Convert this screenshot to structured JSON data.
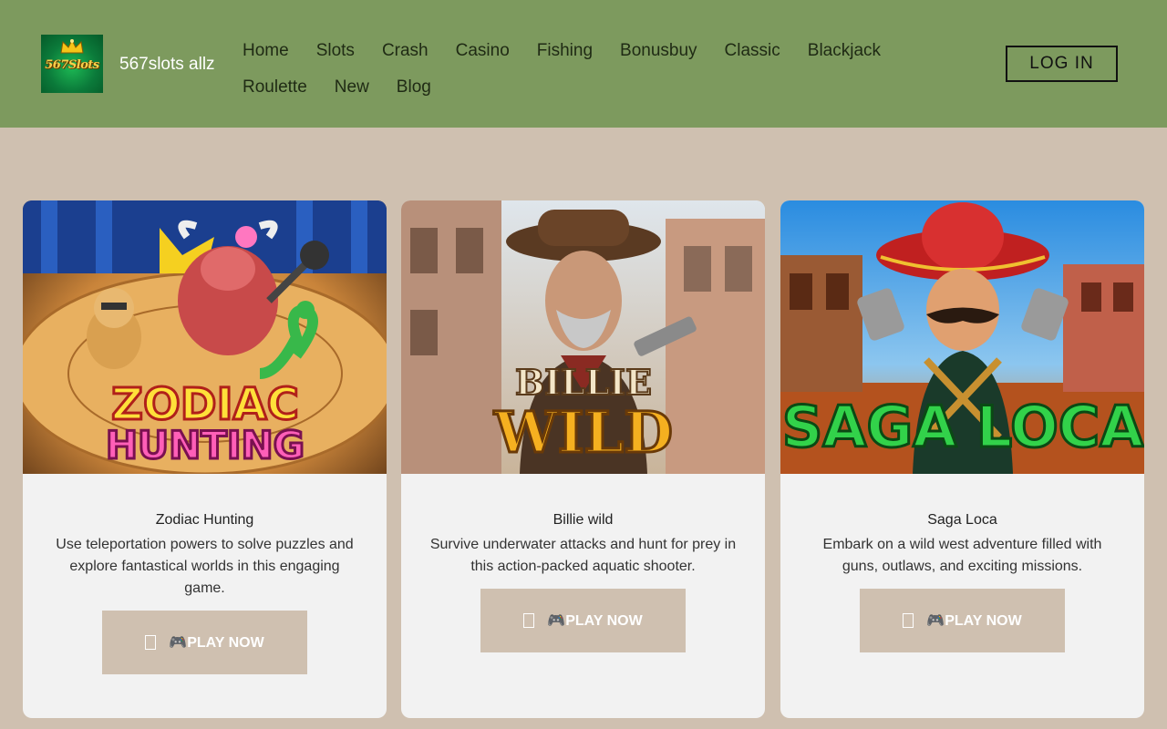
{
  "header": {
    "site_name": "567slots allz",
    "logo_text": "567Slots",
    "nav_row1": [
      "Home",
      "Slots",
      "Crash",
      "Casino",
      "Fishing",
      "Bonusbuy",
      "Classic",
      "Blackjack"
    ],
    "nav_row2": [
      "Roulette",
      "New",
      "Blog"
    ],
    "login_label": "LOG IN"
  },
  "cards": [
    {
      "image_text_1": "ZODIAC",
      "image_text_2": "HUNTING",
      "title": "Zodiac Hunting",
      "description": "Use teleportation powers to solve puzzles and explore fantastical worlds in this engaging game.",
      "button_label": "🎮PLAY NOW"
    },
    {
      "image_text_1": "BILLIE",
      "image_text_2": "WILD",
      "title": "Billie wild",
      "description": "Survive underwater attacks and hunt for prey in this action-packed aquatic shooter.",
      "button_label": "🎮PLAY NOW"
    },
    {
      "image_text_1": "SAGA LOCA",
      "title": "Saga Loca",
      "description": "Embark on a wild west adventure filled with guns, outlaws, and exciting missions.",
      "button_label": "🎮PLAY NOW"
    }
  ],
  "colors": {
    "header_bg": "#7d9a5e",
    "page_bg": "#cfc0b0",
    "card_bg": "#f2f2f2",
    "button_bg": "#cfc0b0"
  }
}
